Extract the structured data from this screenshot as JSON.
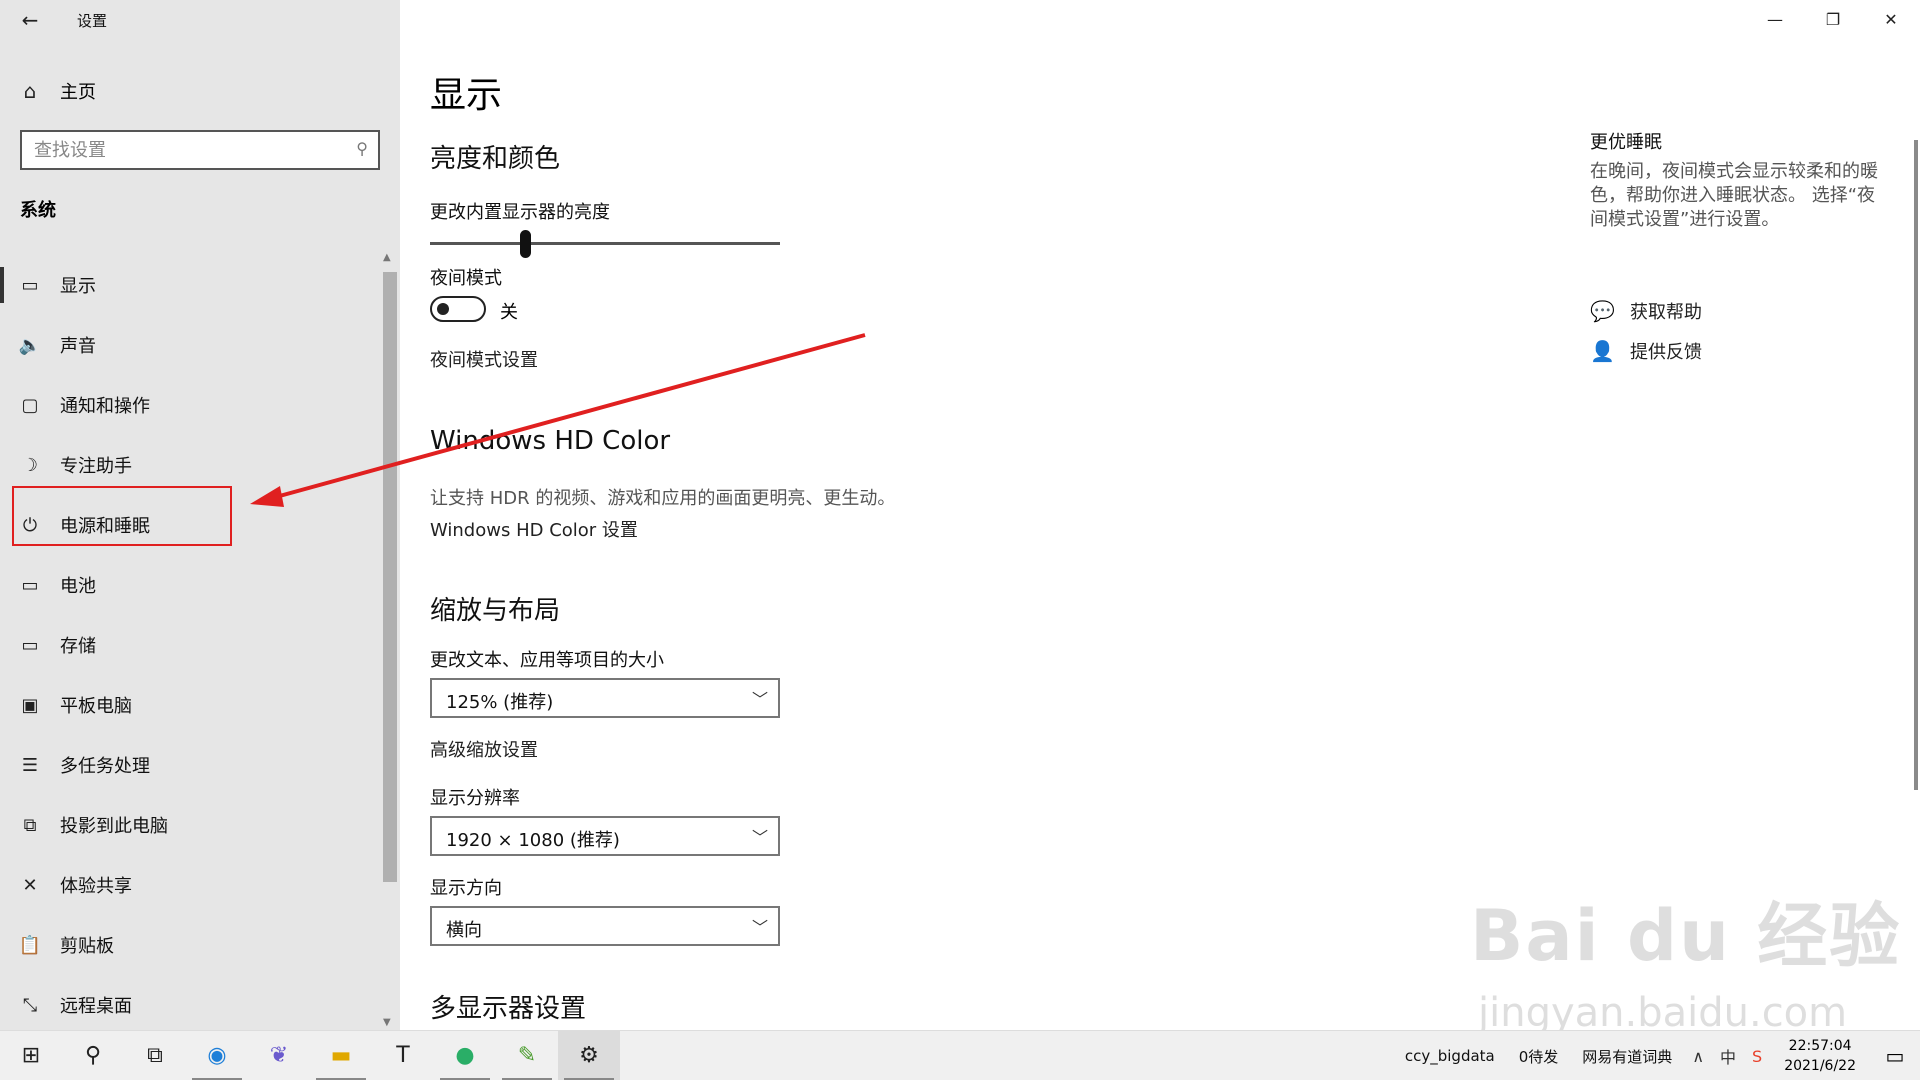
{
  "window": {
    "title": "设置",
    "back_icon": "back-arrow-icon"
  },
  "window_controls": {
    "minimize": "—",
    "restore": "❐",
    "close": "✕"
  },
  "sidebar": {
    "home_label": "主页",
    "search_placeholder": "查找设置",
    "section_title": "系统",
    "items": [
      {
        "label": "显示",
        "icon": "monitor-icon",
        "glyph": "▭"
      },
      {
        "label": "声音",
        "icon": "speaker-icon",
        "glyph": "🔈"
      },
      {
        "label": "通知和操作",
        "icon": "notification-icon",
        "glyph": "▢"
      },
      {
        "label": "专注助手",
        "icon": "moon-icon",
        "glyph": "☽"
      },
      {
        "label": "电源和睡眠",
        "icon": "power-icon",
        "glyph": "⏻"
      },
      {
        "label": "电池",
        "icon": "battery-icon",
        "glyph": "▭"
      },
      {
        "label": "存储",
        "icon": "storage-icon",
        "glyph": "▭"
      },
      {
        "label": "平板电脑",
        "icon": "tablet-icon",
        "glyph": "▣"
      },
      {
        "label": "多任务处理",
        "icon": "multitask-icon",
        "glyph": "☰"
      },
      {
        "label": "投影到此电脑",
        "icon": "project-icon",
        "glyph": "⧉"
      },
      {
        "label": "体验共享",
        "icon": "share-icon",
        "glyph": "✕"
      },
      {
        "label": "剪贴板",
        "icon": "clipboard-icon",
        "glyph": "📋"
      },
      {
        "label": "远程桌面",
        "icon": "remote-desktop-icon",
        "glyph": "⤡"
      }
    ]
  },
  "main": {
    "title": "显示",
    "brightness": {
      "heading": "亮度和颜色",
      "slider_label": "更改内置显示器的亮度",
      "slider_value_percent": 27,
      "night_mode_label": "夜间模式",
      "night_mode_state": "关",
      "night_mode_settings": "夜间模式设置"
    },
    "hdr": {
      "heading": "Windows HD Color",
      "desc": "让支持 HDR 的视频、游戏和应用的画面更明亮、更生动。",
      "link": "Windows HD Color 设置"
    },
    "scale": {
      "heading": "缩放与布局",
      "size_label": "更改文本、应用等项目的大小",
      "size_value": "125% (推荐)",
      "advanced_link": "高级缩放设置",
      "resolution_label": "显示分辨率",
      "resolution_value": "1920 × 1080 (推荐)",
      "orientation_label": "显示方向",
      "orientation_value": "横向"
    },
    "multi": {
      "heading": "多显示器设置"
    }
  },
  "right_pane": {
    "title": "更优睡眠",
    "desc": "在晚间，夜间模式会显示较柔和的暖色，帮助你进入睡眠状态。 选择“夜间模式设置”进行设置。",
    "help": "获取帮助",
    "feedback": "提供反馈"
  },
  "watermark": {
    "brand": "Bai du 经验",
    "url": "jingyan.baidu.com"
  },
  "taskbar": {
    "tray_items": [
      "ccy_bigdata",
      "0待发",
      "网易有道词典"
    ],
    "ime": "中",
    "time": "22:57:04",
    "date": "2021/6/22"
  },
  "colors": {
    "sidebar_bg": "#e6e6e6",
    "annotation_red": "#e02020",
    "taskbar_bg": "#f0f0f0"
  }
}
